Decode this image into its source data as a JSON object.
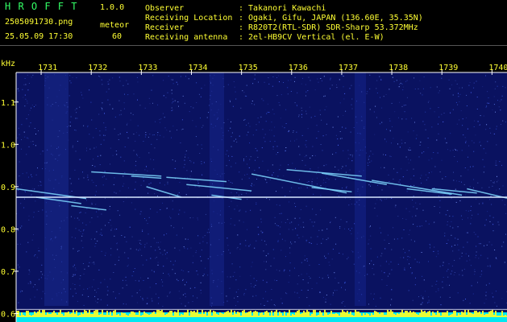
{
  "header": {
    "app_name": "H R O F F T",
    "version": "1.0.0",
    "filename": "2505091730.png",
    "mode": "meteor",
    "date_time": "25.05.09 17:30",
    "count": "60",
    "fields": [
      {
        "label": "Observer",
        "value": ": Takanori Kawachi"
      },
      {
        "label": "Receiving Location",
        "value": ": Ogaki, Gifu, JAPAN (136.60E, 35.35N)"
      },
      {
        "label": "Receiver",
        "value": ": R820T2(RTL-SDR) SDR-Sharp 53.372MHz"
      },
      {
        "label": "Receiving antenna",
        "value": ": 2el-HB9CV Vertical (el. E-W)"
      }
    ]
  },
  "colors": {
    "background": "#0a1260",
    "tick_text": "#ffff33",
    "header_yellow": "#ffff33",
    "header_green": "#33ff66",
    "axis_line": "#ffffff",
    "bottom_band_cyan": "#00ffff",
    "bottom_band_yellow": "#ffff00"
  },
  "chart_data": {
    "type": "heatmap",
    "ylabel": "kHz",
    "x_ticks": [
      "1731",
      "1732",
      "1733",
      "1734",
      "1735",
      "1736",
      "1737",
      "1738",
      "1739",
      "1740"
    ],
    "y_ticks": [
      "1.1",
      "1.0",
      "0.9",
      "0.8",
      "0.7",
      "0.6"
    ],
    "xlim_minutes": [
      1730.5,
      1740.3
    ],
    "ylim_khz": [
      0.58,
      1.17
    ],
    "carrier_khz": 0.875,
    "reference_line_khz": 0.61,
    "meteor_traces": [
      {
        "t": [
          1730.5,
          1731.9
        ],
        "f": [
          0.895,
          0.872
        ]
      },
      {
        "t": [
          1730.9,
          1731.8
        ],
        "f": [
          0.875,
          0.86
        ]
      },
      {
        "t": [
          1731.6,
          1732.3
        ],
        "f": [
          0.855,
          0.845
        ]
      },
      {
        "t": [
          1732.0,
          1733.4
        ],
        "f": [
          0.935,
          0.925
        ]
      },
      {
        "t": [
          1732.8,
          1733.4
        ],
        "f": [
          0.925,
          0.92
        ]
      },
      {
        "t": [
          1733.1,
          1733.8
        ],
        "f": [
          0.9,
          0.875
        ]
      },
      {
        "t": [
          1733.5,
          1734.7
        ],
        "f": [
          0.922,
          0.912
        ]
      },
      {
        "t": [
          1733.9,
          1735.2
        ],
        "f": [
          0.905,
          0.89
        ]
      },
      {
        "t": [
          1734.4,
          1735.0
        ],
        "f": [
          0.88,
          0.87
        ]
      },
      {
        "t": [
          1735.2,
          1737.1
        ],
        "f": [
          0.93,
          0.885
        ]
      },
      {
        "t": [
          1735.9,
          1737.4
        ],
        "f": [
          0.94,
          0.925
        ]
      },
      {
        "t": [
          1736.4,
          1737.2
        ],
        "f": [
          0.898,
          0.888
        ]
      },
      {
        "t": [
          1736.6,
          1737.9
        ],
        "f": [
          0.932,
          0.905
        ]
      },
      {
        "t": [
          1737.6,
          1739.4
        ],
        "f": [
          0.915,
          0.88
        ]
      },
      {
        "t": [
          1738.3,
          1739.2
        ],
        "f": [
          0.895,
          0.882
        ]
      },
      {
        "t": [
          1738.8,
          1739.7
        ],
        "f": [
          0.895,
          0.885
        ]
      },
      {
        "t": [
          1739.5,
          1740.3
        ],
        "f": [
          0.895,
          0.873
        ]
      }
    ]
  }
}
